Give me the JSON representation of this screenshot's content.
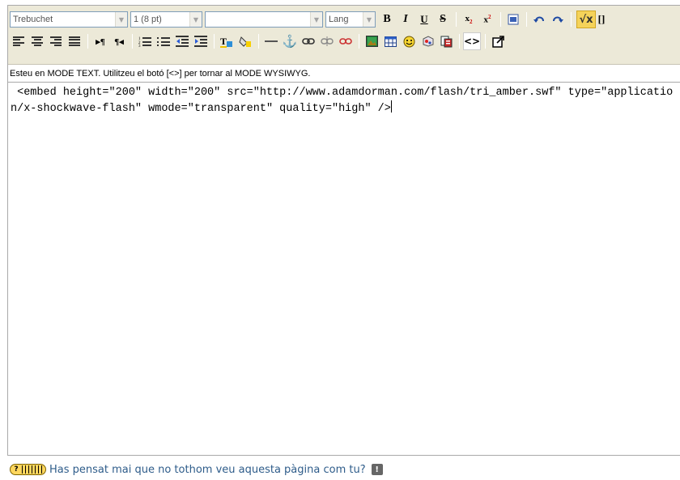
{
  "toolbar": {
    "font_family": "Trebuchet",
    "font_size": "1 (8 pt)",
    "format": "",
    "lang": "Lang",
    "bold": "B",
    "italic": "I",
    "underline": "U",
    "strike": "S",
    "math": "√x"
  },
  "status": "Esteu en MODE TEXT. Utilitzeu el botó [<>] per tornar al MODE WYSIWYG.",
  "content": " <embed height=\"200\" width=\"200\" src=\"http://www.adamdorman.com/flash/tri_amber.swf\" type=\"application/x-shockwave-flash\" wmode=\"transparent\" quality=\"high\" />",
  "footer": {
    "link_text": "Has pensat mai que no tothom veu aquesta pàgina com tu?",
    "help_badge": "?"
  },
  "icons": {
    "align_left": "align-left-icon",
    "align_center": "align-center-icon",
    "align_right": "align-right-icon",
    "justify": "justify-icon",
    "ltr": "ltr-icon",
    "rtl": "rtl-icon",
    "ol": "ordered-list-icon",
    "ul": "unordered-list-icon",
    "outdent": "outdent-icon",
    "indent": "indent-icon",
    "text_color": "text-color-icon",
    "bg_color": "background-color-icon",
    "hr": "horizontal-rule-icon",
    "anchor": "anchor-icon",
    "link": "link-icon",
    "unlink": "unlink-icon",
    "nolink": "nolink-icon",
    "image": "image-icon",
    "table": "table-icon",
    "smiley": "smiley-icon",
    "special_char": "special-char-icon",
    "search_replace": "search-replace-icon",
    "html_source": "html-source-icon",
    "fullscreen": "fullscreen-icon"
  }
}
